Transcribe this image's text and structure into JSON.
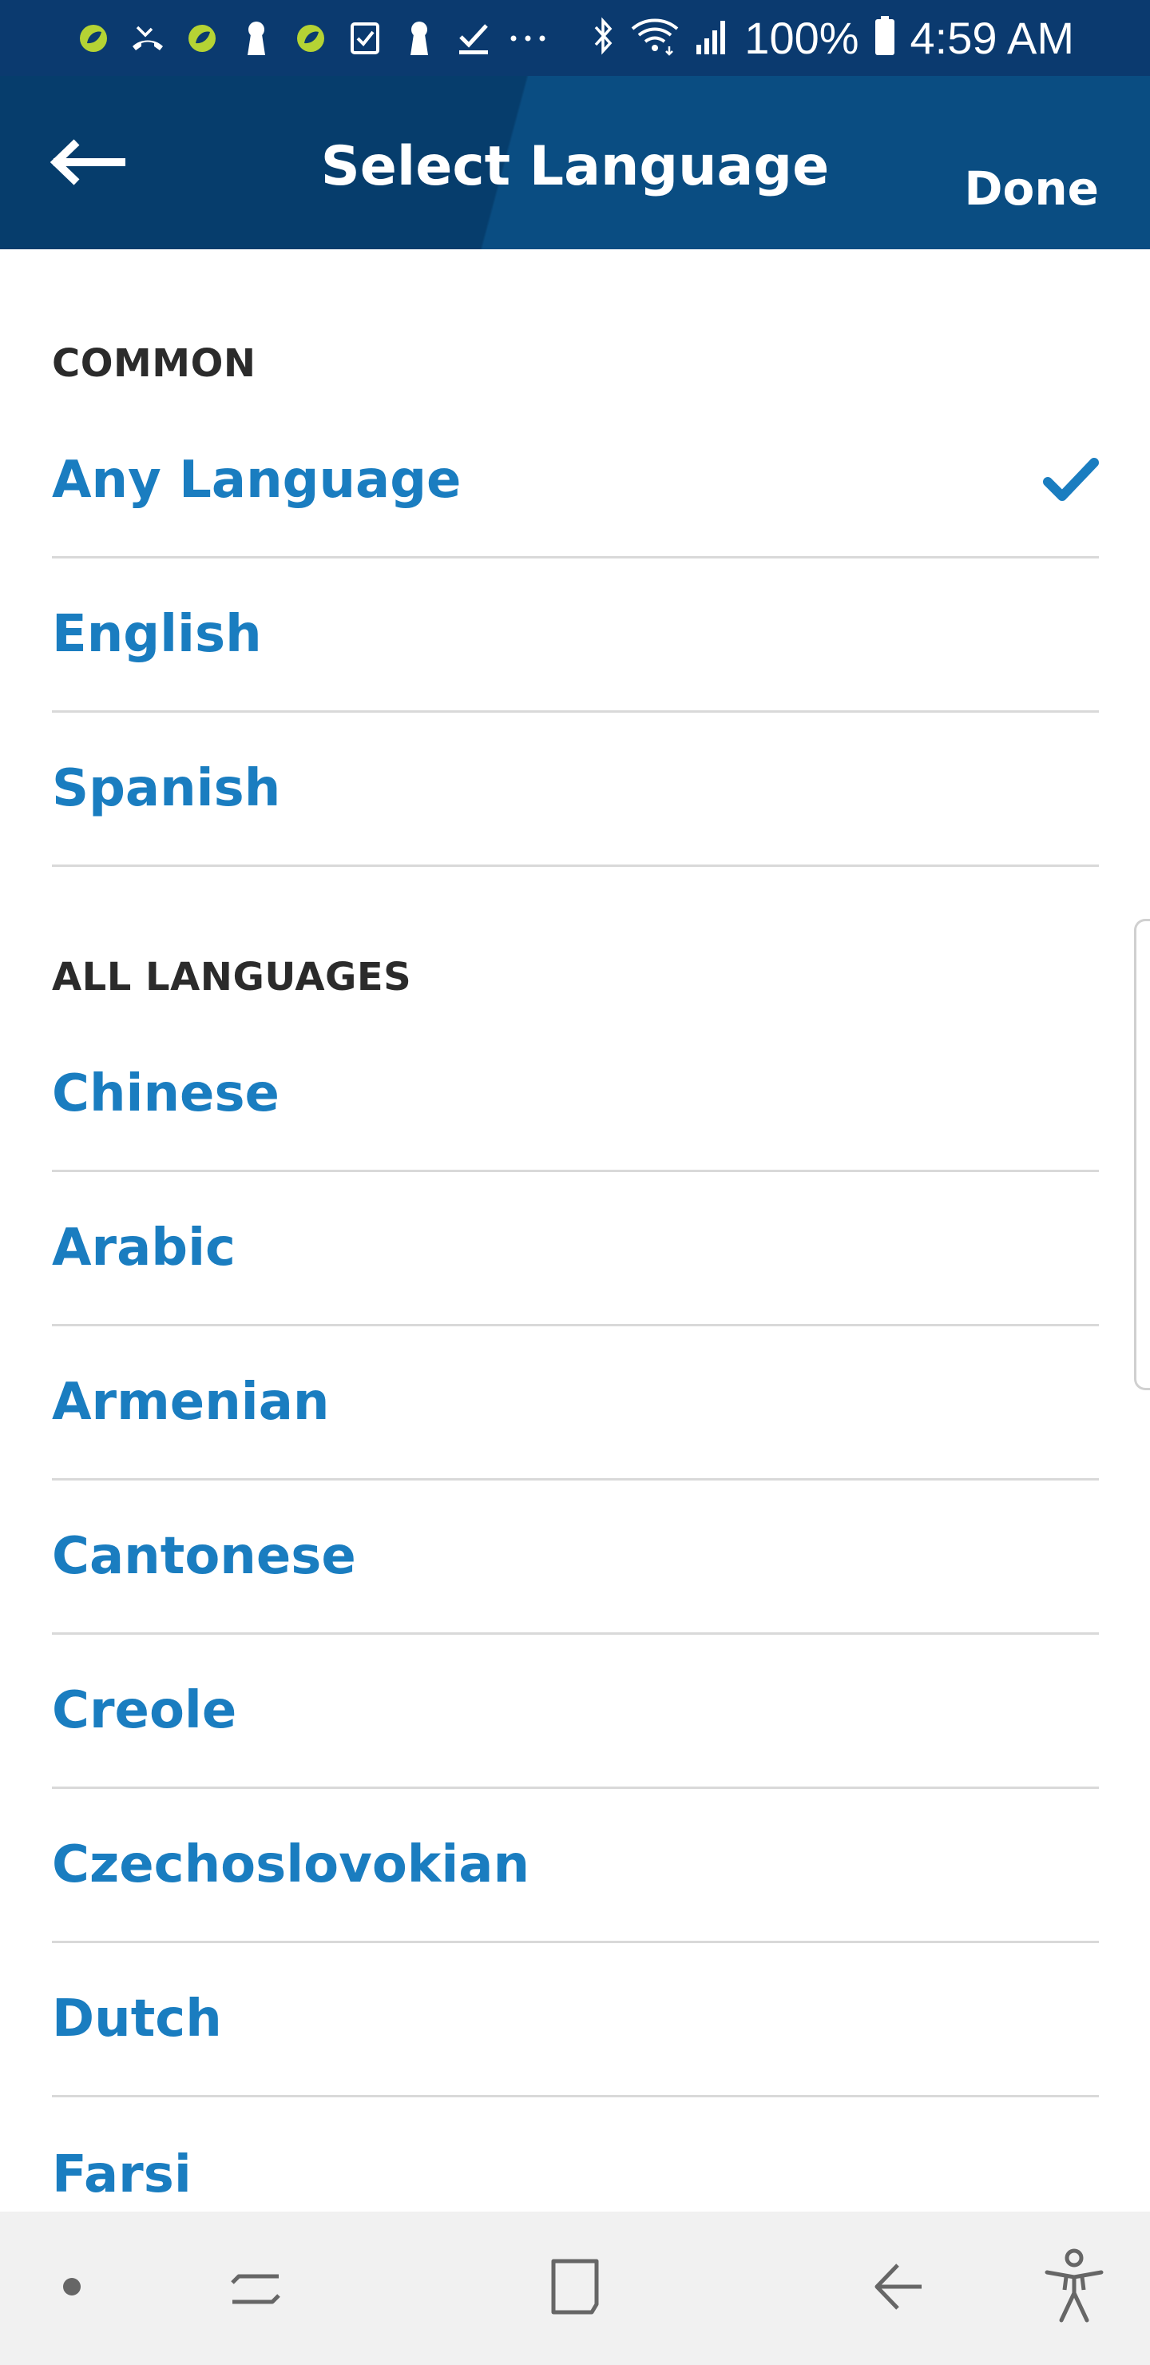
{
  "status_bar": {
    "battery": "100%",
    "time": "4:59 AM",
    "icons": [
      "app-leaf-icon",
      "missed-call-icon",
      "app-leaf-icon",
      "keyhole-icon",
      "app-leaf-icon",
      "checkbox-icon",
      "keyhole-icon",
      "download-check-icon",
      "more-dots-icon",
      "bluetooth-icon",
      "wifi-icon",
      "signal-icon",
      "battery-icon"
    ],
    "colors": {
      "background": "#0b3a6f",
      "leaf": "#b5d334"
    }
  },
  "header": {
    "title": "Select Language",
    "done_label": "Done",
    "back_icon": "arrow-left-icon",
    "colors": {
      "dark": "#063d6c",
      "light": "#0a4d82"
    }
  },
  "sections": [
    {
      "title": "COMMON",
      "items": [
        {
          "label": "Any Language",
          "selected": true
        },
        {
          "label": "English",
          "selected": false
        },
        {
          "label": "Spanish",
          "selected": false
        }
      ]
    },
    {
      "title": "ALL LANGUAGES",
      "items": [
        {
          "label": "Chinese",
          "selected": false
        },
        {
          "label": "Arabic",
          "selected": false
        },
        {
          "label": "Armenian",
          "selected": false
        },
        {
          "label": "Cantonese",
          "selected": false
        },
        {
          "label": "Creole",
          "selected": false
        },
        {
          "label": "Czechoslovokian",
          "selected": false
        },
        {
          "label": "Dutch",
          "selected": false
        },
        {
          "label": "Farsi",
          "selected": false
        }
      ]
    }
  ],
  "colors": {
    "accent": "#1a7dc0",
    "section_header": "#2b2b2b",
    "divider": "#d9d9d9",
    "nav_bar": "#f1f1f1"
  },
  "nav_bar": {
    "icons": [
      "dot-icon",
      "recent-apps-icon",
      "home-square-icon",
      "back-arrow-icon",
      "accessibility-icon"
    ]
  }
}
